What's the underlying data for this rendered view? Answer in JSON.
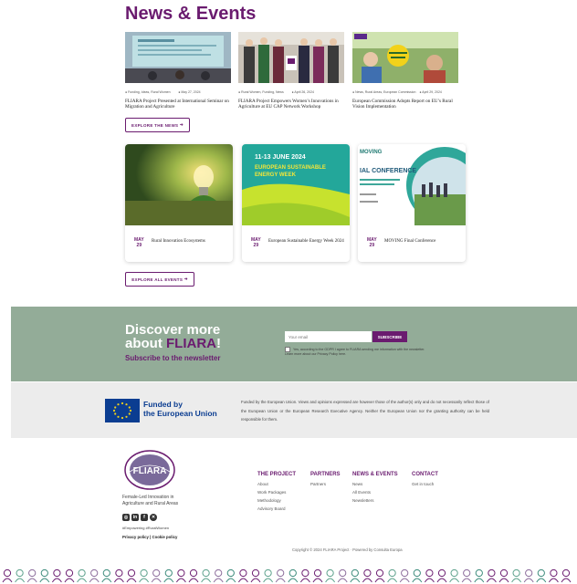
{
  "section_title": "News & Events",
  "news": [
    {
      "meta_left": "Funding, Ideas, Rural Women",
      "meta_right": "May 27, 2024",
      "title": "FLIARA Project Presented at International Seminar on Migration and Agriculture"
    },
    {
      "meta_left": "Rural Women, Funding, News",
      "meta_right": "April 26, 2024",
      "title": "FLIARA Project Empowers Women’s Innovations in Agriculture at EU CAP Network Workshop"
    },
    {
      "meta_left": "News, Rural Areas, European Commission",
      "meta_right": "April 29, 2024",
      "title": "European Commission Adopts Report on EU’s Rural Vision Implementation"
    }
  ],
  "explore_news_label": "EXPLORE THE NEWS",
  "events": [
    {
      "month": "MAY",
      "day": "29",
      "title": "Rural Innovation Ecosystems"
    },
    {
      "month": "MAY",
      "day": "29",
      "title": "European Sustainable Energy Week 2024",
      "banner_date": "11-13 JUNE 2024",
      "banner_title": "EUROPEAN SUSTAINABLE ENERGY WEEK"
    },
    {
      "month": "MAY",
      "day": "29",
      "title": "MOVING Final Conference",
      "banner_brand": "MOVING",
      "banner_title": "IAL CONFERENCE"
    }
  ],
  "explore_events_label": "EXPLORE ALL EVENTS",
  "newsletter": {
    "line1": "Discover more",
    "line2_prefix": "about ",
    "brand": "FLIARA",
    "line2_suffix": "!",
    "subtitle": "Subscribe to the newsletter",
    "placeholder": "Your email",
    "submit": "SUBSCRIBE",
    "consent": "Yes, according to the GDPR I agree to FLIARA sending me information with the newsletter. Learn more about our Privacy Policy here."
  },
  "eu": {
    "funded_line1": "Funded by",
    "funded_line2": "the European Union",
    "disclaimer": "Funded by the European Union. Views and opinions expressed are however those of the author(s) only and do not necessarily reflect those of the European Union or the European Research Executive Agency. Neither the European Union nor the granting authority can be held responsible for them."
  },
  "footer": {
    "logo_text": "FLIARA",
    "tagline": "Female-Led Innovation in Agriculture and Rural Areas",
    "socials": [
      "instagram-icon",
      "linkedin-icon",
      "facebook-icon",
      "x-icon"
    ],
    "social_glyphs": [
      "◎",
      "in",
      "f",
      "✕"
    ],
    "hashtags": "#Empowering  #RuralWomen",
    "privacy": "Privacy policy",
    "separator": " | ",
    "cookie": "Cookie policy",
    "columns": [
      {
        "heading": "THE PROJECT",
        "links": [
          "About",
          "Work Packages",
          "Methodology",
          "Advisory Board"
        ]
      },
      {
        "heading": "PARTNERS",
        "links": [
          "Partners"
        ]
      },
      {
        "heading": "NEWS & EVENTS",
        "links": [
          "News",
          "All Events",
          "Newsletters"
        ]
      },
      {
        "heading": "CONTACT",
        "links": [
          "Get in touch"
        ]
      }
    ],
    "copyright": "Copyright © 2024 FLIARA Project · Powered by Consulta Europa"
  },
  "colors": {
    "brand": "#6a1b6f",
    "sage": "#93ac98",
    "eu_blue": "#0b3d91"
  }
}
